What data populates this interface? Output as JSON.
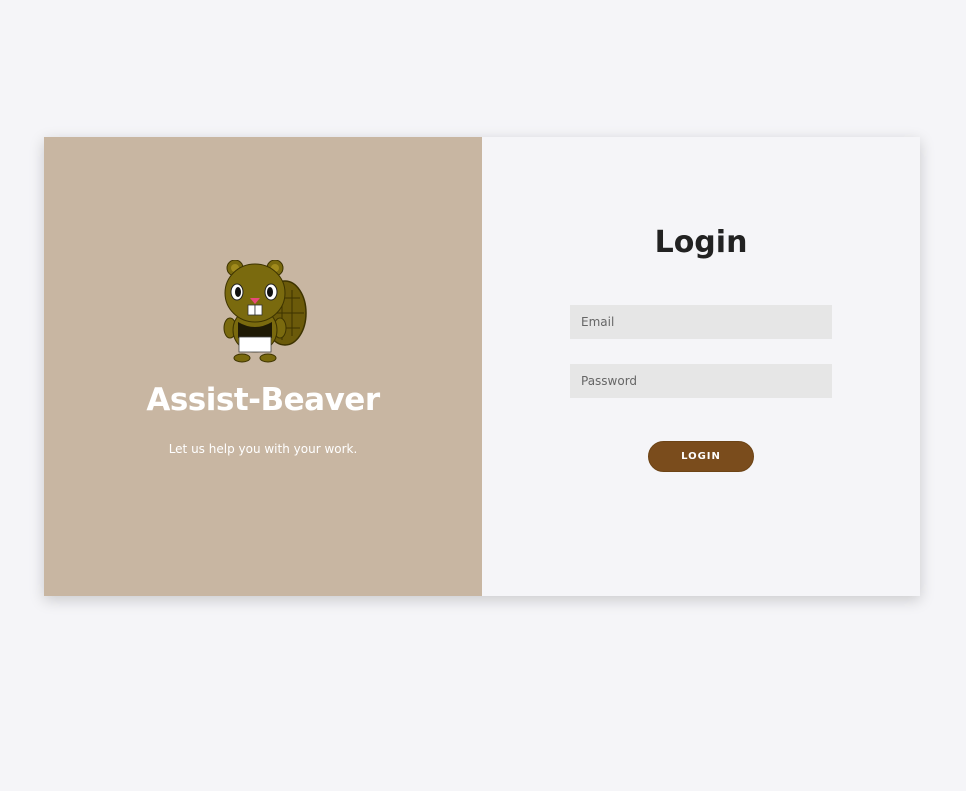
{
  "brand": {
    "title": "Assist-Beaver",
    "tagline": "Let us help you with your work.",
    "panel_color": "#c8b6a2",
    "mascot_icon": "beaver-mascot"
  },
  "login": {
    "title": "Login",
    "email_placeholder": "Email",
    "email_value": "",
    "password_placeholder": "Password",
    "password_value": "",
    "button_label": "LOGIN",
    "button_color": "#7a4c1c"
  }
}
